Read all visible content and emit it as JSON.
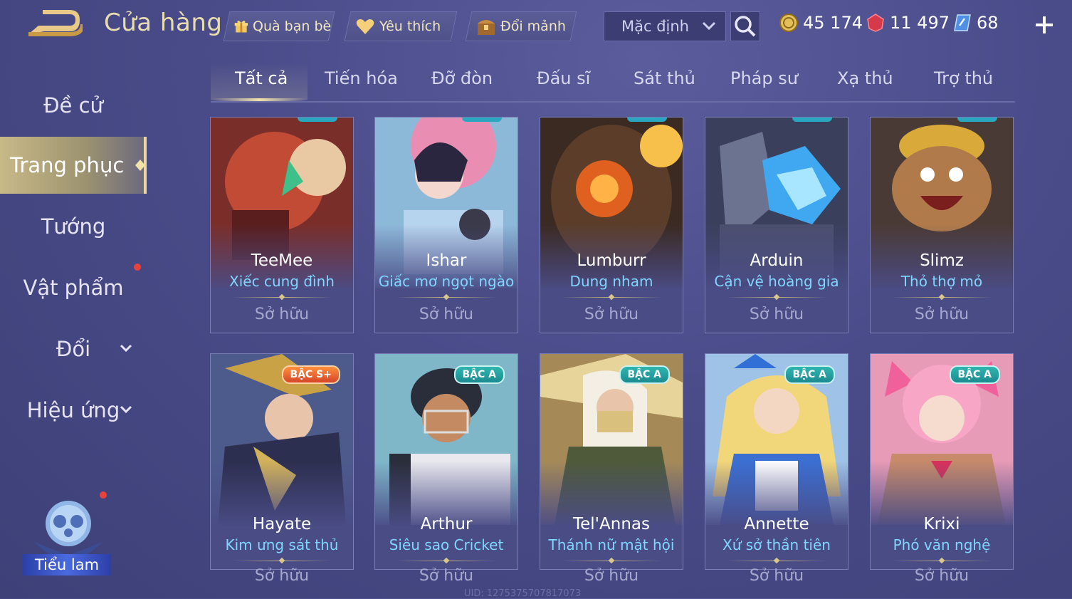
{
  "header": {
    "title": "Cửa hàng",
    "gift_label": "Quà bạn bè",
    "favorite_label": "Yêu thích",
    "exchange_label": "Đổi mảnh",
    "sort_value": "Mặc định",
    "currencies": {
      "gold": "45 174",
      "vouchers": "11 497",
      "tokens": "68"
    }
  },
  "sidebar": {
    "items": [
      {
        "label": "Đề cử"
      },
      {
        "label": "Trang phục"
      },
      {
        "label": "Tướng"
      },
      {
        "label": "Vật phẩm"
      },
      {
        "label": "Đổi"
      },
      {
        "label": "Hiệu ứng"
      }
    ],
    "mascot_label": "Tiểu lam"
  },
  "tabs": [
    "Tất cả",
    "Tiến hóa",
    "Đỡ đòn",
    "Đấu sĩ",
    "Sát thủ",
    "Pháp sư",
    "Xạ thủ",
    "Trợ thủ"
  ],
  "cards": [
    {
      "hero": "TeeMee",
      "skin": "Xiếc cung đình",
      "status": "Sở hữu"
    },
    {
      "hero": "Ishar",
      "skin": "Giấc mơ ngọt ngào",
      "status": "Sở hữu"
    },
    {
      "hero": "Lumburr",
      "skin": "Dung nham",
      "status": "Sở hữu"
    },
    {
      "hero": "Arduin",
      "skin": "Cận vệ hoàng gia",
      "status": "Sở hữu"
    },
    {
      "hero": "Slimz",
      "skin": "Thỏ thợ mỏ",
      "status": "Sở hữu"
    },
    {
      "hero": "Hayate",
      "skin": "Kim ưng sát thủ",
      "status": "Sở hữu",
      "badge": "BẬC S+"
    },
    {
      "hero": "Arthur",
      "skin": "Siêu sao Cricket",
      "status": "Sở hữu",
      "badge": "BẬC A"
    },
    {
      "hero": "Tel'Annas",
      "skin": "Thánh nữ mật hội",
      "status": "Sở hữu",
      "badge": "BẬC A"
    },
    {
      "hero": "Annette",
      "skin": "Xứ sở thần tiên",
      "status": "Sở hữu",
      "badge": "BẬC A"
    },
    {
      "hero": "Krixi",
      "skin": "Phó văn nghệ",
      "status": "Sở hữu",
      "badge": "BẬC A"
    }
  ],
  "uid_text": "UID: 1275375707817073",
  "colors": {
    "accent_gold": "#e9ddb0",
    "skin_name": "#7fd6ff",
    "badge_a": "#2fb6b0",
    "badge_splus": "#ff8f3b",
    "notify_dot": "#e8433a"
  }
}
